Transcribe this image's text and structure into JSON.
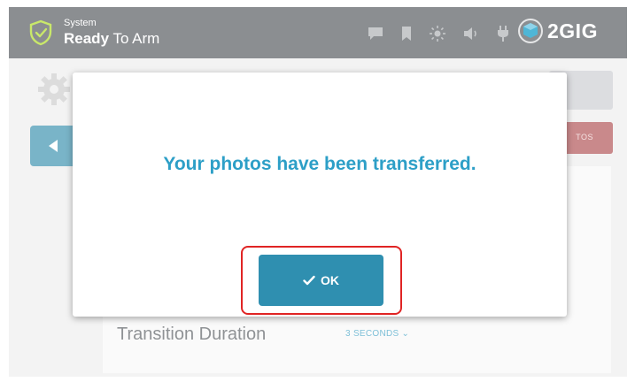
{
  "header": {
    "system_label": "System",
    "status_prefix": "Ready",
    "status_suffix": " To Arm",
    "icons": [
      "shield-check-icon",
      "chat-icon",
      "bookmark-icon",
      "brightness-icon",
      "volume-icon",
      "power-plug-icon"
    ],
    "logo_text": "2GIG"
  },
  "background": {
    "photos_button_label": "TOS",
    "row_label": "Transition Duration",
    "row_value": "3 SECONDS",
    "row_value_chevron": "⌄"
  },
  "modal": {
    "message": "Your photos have been transferred.",
    "ok_label": "OK",
    "ok_icon": "checkmark-icon"
  },
  "colors": {
    "header_bg": "#8b8e91",
    "accent_blue": "#2d9fc7",
    "ok_button": "#2f8fb0",
    "highlight_red": "#e02424",
    "back_button": "#79b4c8",
    "photos_button": "#c9898b"
  }
}
